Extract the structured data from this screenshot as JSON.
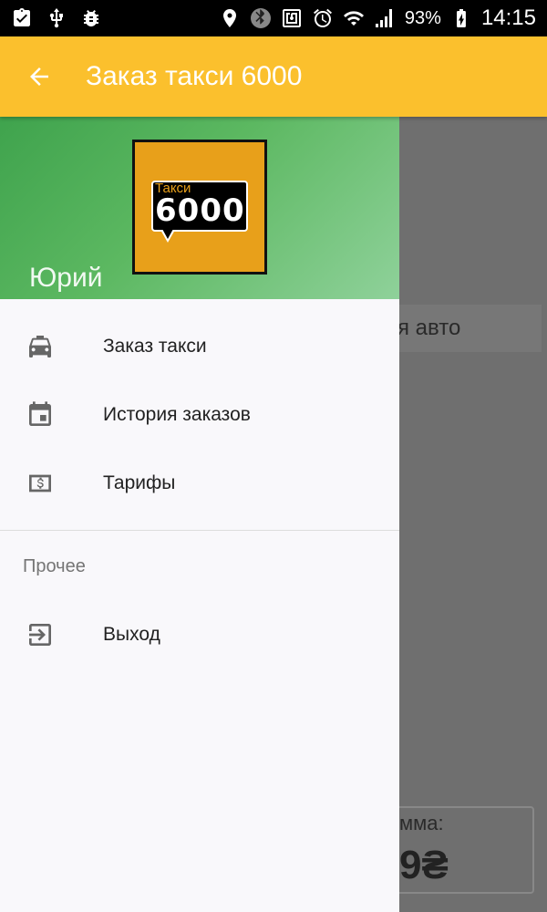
{
  "status_bar": {
    "battery_percent": "93%",
    "time": "14:15"
  },
  "toolbar": {
    "title": "Заказ такси 6000"
  },
  "background": {
    "field_text": "я авто",
    "sum_label": "мма:",
    "sum_value": "9₴"
  },
  "drawer": {
    "logo": {
      "small_text": "Такси",
      "big_text": "6000"
    },
    "user_name": "Юрий",
    "items": [
      {
        "label": "Заказ такси",
        "icon": "taxi-icon"
      },
      {
        "label": "История заказов",
        "icon": "calendar-icon"
      },
      {
        "label": "Тарифы",
        "icon": "dollar-icon"
      }
    ],
    "section_title": "Прочее",
    "other_items": [
      {
        "label": "Выход",
        "icon": "exit-icon"
      }
    ]
  }
}
